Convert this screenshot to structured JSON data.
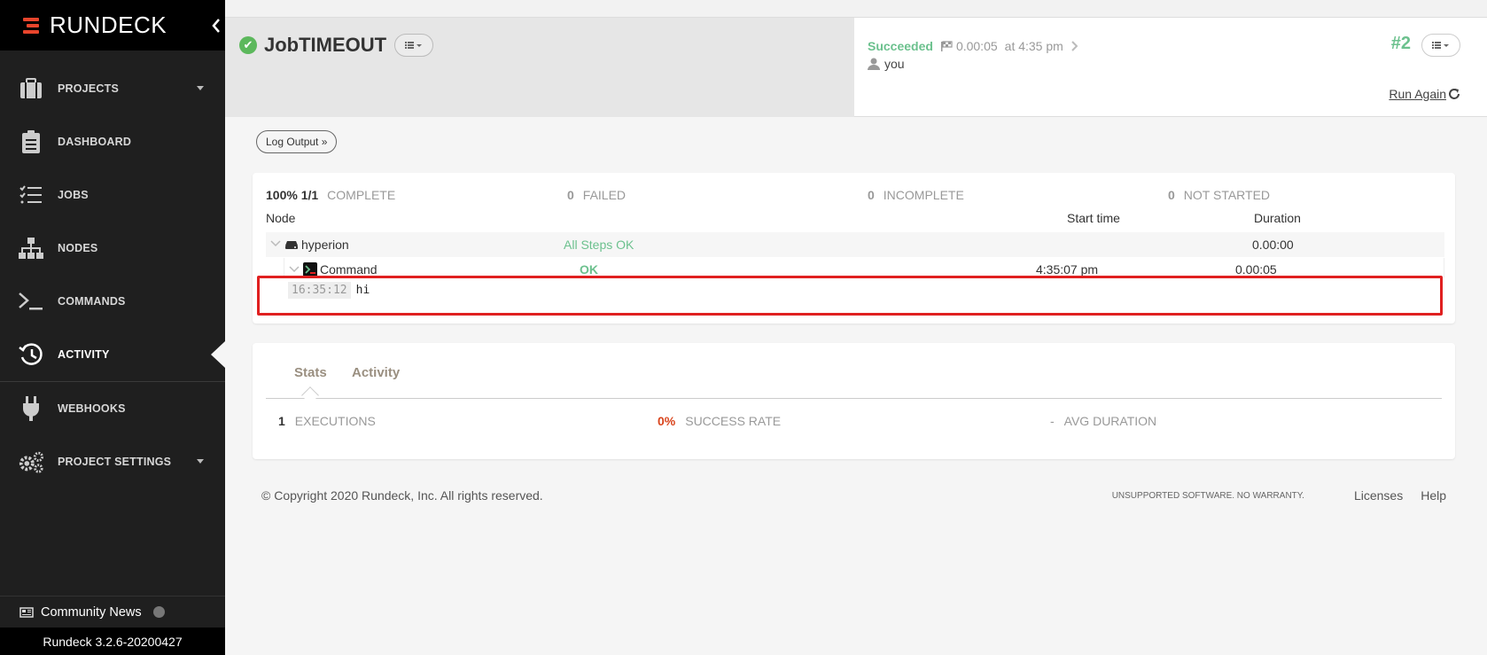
{
  "brand": {
    "name": "RUNDECK",
    "accent": "#e8452c"
  },
  "sidebar": {
    "items": [
      {
        "label": "PROJECTS",
        "icon": "briefcase-icon",
        "has_caret": true
      },
      {
        "label": "DASHBOARD",
        "icon": "clipboard-icon"
      },
      {
        "label": "JOBS",
        "icon": "task-list-icon"
      },
      {
        "label": "NODES",
        "icon": "sitemap-icon"
      },
      {
        "label": "COMMANDS",
        "icon": "terminal-icon"
      },
      {
        "label": "ACTIVITY",
        "icon": "history-icon",
        "active": true
      },
      {
        "label": "WEBHOOKS",
        "icon": "plug-icon"
      },
      {
        "label": "PROJECT SETTINGS",
        "icon": "gears-icon",
        "has_caret": true
      }
    ],
    "community_news": "Community News",
    "version": "Rundeck 3.2.6-20200427"
  },
  "job": {
    "title": "JobTIMEOUT",
    "status": "Succeeded",
    "duration": "0.00:05",
    "time": "at 4:35 pm",
    "user": "you",
    "exec_number": "#2",
    "run_again": "Run Again"
  },
  "log_output_button": "Log Output »",
  "summary": {
    "complete_pct": "100% 1/1",
    "complete_label": "COMPLETE",
    "failed_count": "0",
    "failed_label": "FAILED",
    "incomplete_count": "0",
    "incomplete_label": "INCOMPLETE",
    "not_started_count": "0",
    "not_started_label": "NOT STARTED"
  },
  "node_table": {
    "headers": {
      "node": "Node",
      "start_time": "Start time",
      "duration": "Duration"
    },
    "node": {
      "name": "hyperion",
      "status": "All Steps OK",
      "duration": "0.00:00"
    },
    "step": {
      "name": "Command",
      "status": "OK",
      "start_time": "4:35:07 pm",
      "duration": "0.00:05"
    }
  },
  "log_line": {
    "time": "16:35:12",
    "text": "hi"
  },
  "stats": {
    "tabs": [
      "Stats",
      "Activity"
    ],
    "executions_count": "1",
    "executions_label": "EXECUTIONS",
    "success_rate": "0%",
    "success_rate_label": "SUCCESS RATE",
    "avg_duration": "-",
    "avg_duration_label": "AVG DURATION"
  },
  "footer": {
    "copyright": "© Copyright 2020 Rundeck, Inc. All rights reserved.",
    "warranty": "UNSUPPORTED SOFTWARE. NO WARRANTY.",
    "licenses": "Licenses",
    "help": "Help"
  },
  "colors": {
    "success": "#6cc18e",
    "danger": "#d9441c",
    "highlight": "#e02020"
  }
}
